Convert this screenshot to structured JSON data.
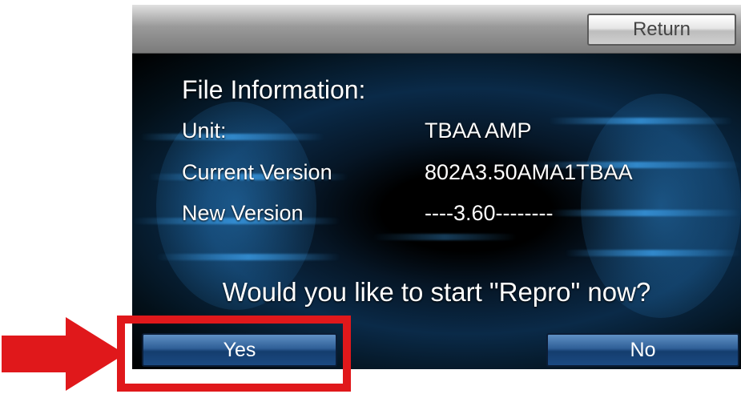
{
  "toolbar": {
    "return_label": "Return"
  },
  "file_info": {
    "title": "File Information:",
    "rows": [
      {
        "label": "Unit:",
        "value": "TBAA AMP"
      },
      {
        "label": "Current Version",
        "value": "802A3.50AMA1TBAA"
      },
      {
        "label": "New Version",
        "value": "----3.60--------"
      }
    ]
  },
  "prompt": {
    "question": "Would you like to start \"Repro\" now?",
    "yes_label": "Yes",
    "no_label": "No"
  },
  "annotation": {
    "highlight_color": "#e0181b",
    "arrow_color": "#e0181b",
    "arrow_icon": "right-arrow-icon"
  },
  "colors": {
    "button_blue": "#2f5f97",
    "topbar_gray": "#9a9a9a",
    "screen_background": "#000000"
  }
}
